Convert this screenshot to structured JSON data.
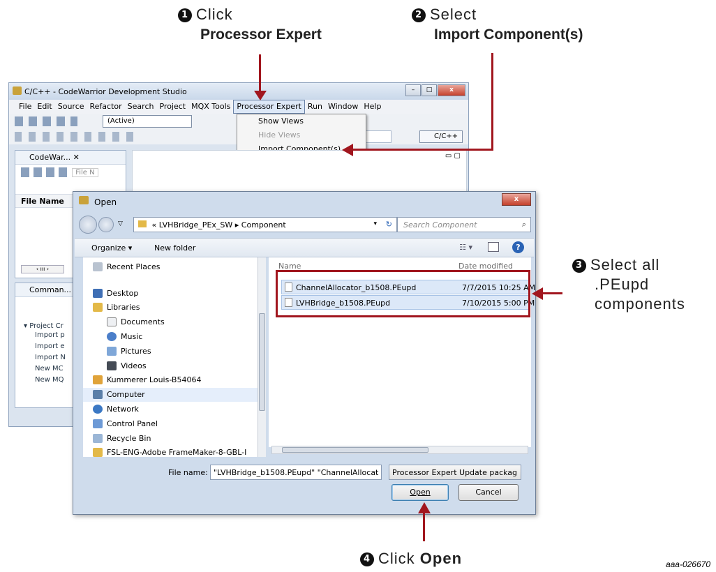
{
  "steps": {
    "step1": {
      "num": "1",
      "line1": "Click",
      "line2": "Processor Expert"
    },
    "step2": {
      "num": "2",
      "line1": "Select",
      "line2": "Import Component(s)"
    },
    "step3": {
      "num": "3",
      "line1": "Select all",
      "line2": ".PEupd",
      "line3": "components"
    },
    "step4": {
      "num": "4",
      "prefix": "Click",
      "bold": "Open"
    }
  },
  "figure_id": "aaa-026670",
  "ide": {
    "title": "C/C++ - CodeWarrior Development Studio",
    "menu": [
      "File",
      "Edit",
      "Source",
      "Refactor",
      "Search",
      "Project",
      "MQX Tools",
      "Processor Expert",
      "Run",
      "Window",
      "Help"
    ],
    "config": "(Active)",
    "perspective": "C/C++",
    "dropdown": [
      "Show Views",
      "Hide Views",
      "Import Component(s)"
    ],
    "panel1_tab": "CodeWar...",
    "panel1_filter": "File N",
    "panel1_column": "File Name",
    "panel2_tab": "Comman...",
    "panel2_section": "Project Cr",
    "panel2_items": [
      "Import p",
      "Import e",
      "Import N",
      "New MC",
      "New MQ"
    ]
  },
  "dialog": {
    "title": "Open",
    "path": [
      "«",
      "LVHBridge_PEx_SW",
      "▸",
      "Component"
    ],
    "search_placeholder": "Search Component",
    "organize": "Organize ▾",
    "new_folder": "New folder",
    "nav_items": [
      "Recent Places",
      "Desktop",
      "Libraries",
      "Documents",
      "Music",
      "Pictures",
      "Videos",
      "Kummerer Louis-B54064",
      "Computer",
      "Network",
      "Control Panel",
      "Recycle Bin",
      "FSL-ENG-Adobe FrameMaker-8-GBL-I"
    ],
    "col_name": "Name",
    "col_date": "Date modified",
    "files": [
      {
        "name": "ChannelAllocator_b1508.PEupd",
        "date": "7/7/2015 10:25 AM"
      },
      {
        "name": "LVHBridge_b1508.PEupd",
        "date": "7/10/2015 5:00 PM"
      }
    ],
    "filename_label": "File name:",
    "filename_value": "\"LVHBridge_b1508.PEupd\" \"ChannelAllocat",
    "filetype": "Processor Expert Update packag",
    "open_label": "Open",
    "cancel_label": "Cancel"
  }
}
